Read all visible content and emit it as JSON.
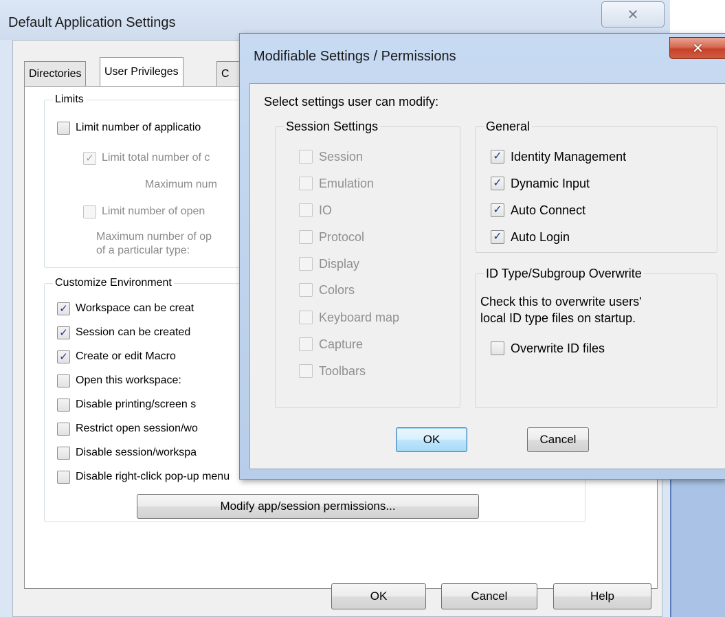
{
  "background_window": {
    "title": "Default Application Settings",
    "close_glyph": "✕",
    "tabs": [
      "Directories",
      "User Privileges",
      "C"
    ],
    "limits": {
      "legend": "Limits",
      "limit_apps": "Limit number of applicatio",
      "limit_total": "Limit total number of c",
      "max_num": "Maximum num",
      "limit_open": "Limit number of open",
      "max_open_1": "Maximum number of op",
      "max_open_2": "of a particular type:"
    },
    "customize": {
      "legend": "Customize Environment",
      "items": [
        {
          "label": "Workspace can be creat",
          "checked": true
        },
        {
          "label": "Session can be created",
          "checked": true
        },
        {
          "label": "Create or edit Macro",
          "checked": true
        },
        {
          "label": "Open this workspace:",
          "checked": false
        },
        {
          "label": "Disable printing/screen s",
          "checked": false
        },
        {
          "label": "Restrict open session/wo",
          "checked": false
        },
        {
          "label": "Disable session/workspa",
          "checked": false
        },
        {
          "label": "Disable right-click pop-up menu",
          "checked": false
        }
      ],
      "modify_button": "Modify app/session permissions..."
    },
    "buttons": {
      "ok": "OK",
      "cancel": "Cancel",
      "help": "Help"
    }
  },
  "dialog": {
    "title": "Modifiable Settings / Permissions",
    "close_glyph": "✕",
    "prompt": "Select settings user can modify:",
    "session_settings": {
      "legend": "Session Settings",
      "items": [
        "Session",
        "Emulation",
        "IO",
        "Protocol",
        "Display",
        "Colors",
        "Keyboard map",
        "Capture",
        "Toolbars"
      ]
    },
    "general": {
      "legend": "General",
      "items": [
        {
          "label": "Identity Management",
          "checked": true
        },
        {
          "label": "Dynamic Input",
          "checked": true
        },
        {
          "label": "Auto Connect",
          "checked": true
        },
        {
          "label": "Auto Login",
          "checked": true
        }
      ]
    },
    "id_type": {
      "legend": "ID Type/Subgroup Overwrite",
      "desc_1": "Check this to overwrite users'",
      "desc_2": "local ID type files on startup.",
      "overwrite_label": "Overwrite ID files",
      "overwrite_checked": false
    },
    "buttons": {
      "ok": "OK",
      "cancel": "Cancel"
    }
  },
  "check_glyph": "✓"
}
